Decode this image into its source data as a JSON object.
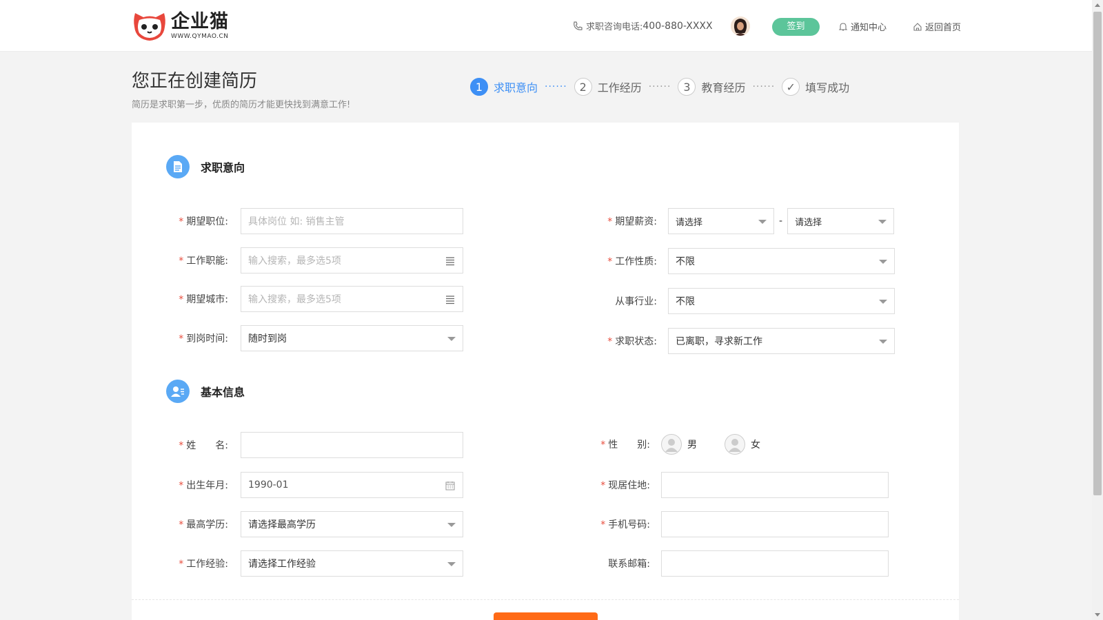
{
  "header": {
    "logo_name": "企业猫",
    "logo_url": "WWW.QYMAO.CN",
    "hotline_label": "求职咨询电话:",
    "hotline_number": "400-880-XXXX",
    "signin_label": "签到",
    "notify_label": "通知中心",
    "home_label": "返回首页"
  },
  "page": {
    "title": "您正在创建简历",
    "subtitle": "简历是求职第一步，优质的简历才能更快找到满意工作!"
  },
  "steps": [
    {
      "num": "1",
      "label": "求职意向",
      "active": true
    },
    {
      "num": "2",
      "label": "工作经历",
      "active": false
    },
    {
      "num": "3",
      "label": "教育经历",
      "active": false
    },
    {
      "num": "✓",
      "label": "填写成功",
      "active": false
    }
  ],
  "step_separator": "······",
  "intent": {
    "title": "求职意向",
    "position_label": "期望职位:",
    "position_placeholder": "具体岗位 如: 销售主管",
    "function_label": "工作职能:",
    "function_placeholder": "输入搜索，最多选5项",
    "city_label": "期望城市:",
    "city_placeholder": "输入搜索，最多选5项",
    "arrival_label": "到岗时间:",
    "arrival_value": "随时到岗",
    "salary_label": "期望薪资:",
    "salary_min": "请选择",
    "salary_max": "请选择",
    "salary_dash": "-",
    "nature_label": "工作性质:",
    "nature_value": "不限",
    "industry_label": "从事行业:",
    "industry_value": "不限",
    "status_label": "求职状态:",
    "status_value": "已离职，寻求新工作"
  },
  "basic": {
    "title": "基本信息",
    "name_label": "姓　　名:",
    "name_value": "",
    "birth_label": "出生年月:",
    "birth_value": "1990-01",
    "education_label": "最高学历:",
    "education_value": "请选择最高学历",
    "experience_label": "工作经验:",
    "experience_value": "请选择工作经验",
    "gender_label": "性　　别:",
    "gender_options": [
      "男",
      "女"
    ],
    "address_label": "现居住地:",
    "address_value": "",
    "phone_label": "手机号码:",
    "phone_value": "",
    "email_label": "联系邮箱:",
    "email_value": ""
  },
  "required_mark": "*",
  "colors": {
    "accent": "#3d8ff5",
    "signin": "#5cc59a",
    "required": "#e84d3d",
    "next_button": "#ff6a16"
  }
}
